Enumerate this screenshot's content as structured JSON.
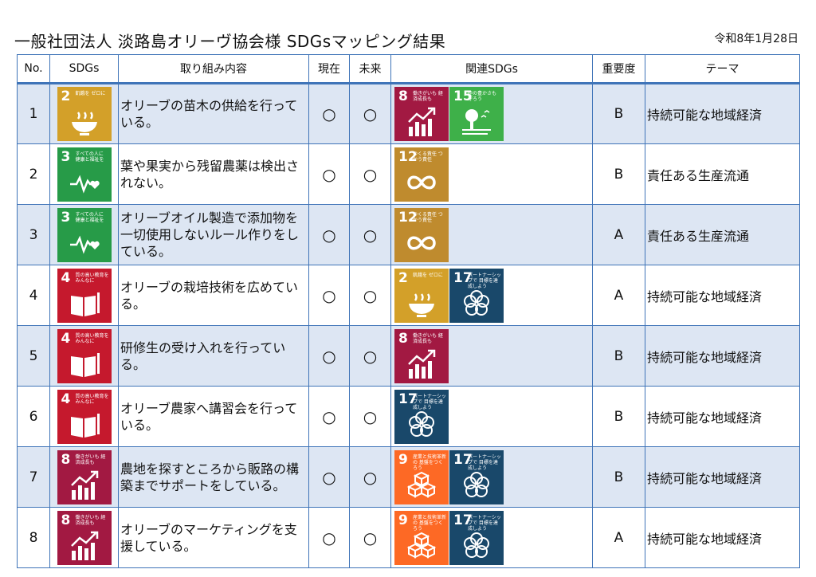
{
  "header": {
    "title": "一般社団法人 淡路島オリーヴ協会様 SDGsマッピング結果",
    "date": "令和8年1月28日"
  },
  "columns": [
    "No.",
    "SDGs",
    "取り組み内容",
    "現在",
    "未来",
    "関連SDGs",
    "重要度",
    "テーマ"
  ],
  "goal_tiles": {
    "g2": {
      "num": "2",
      "text": "飢餓を ゼロに",
      "color": "#d3a029",
      "icon": "bowl-icon"
    },
    "g3": {
      "num": "3",
      "text": "すべての人に 健康と福祉を",
      "color": "#279b48",
      "icon": "heartbeat-icon"
    },
    "g4": {
      "num": "4",
      "text": "質の高い教育を みんなに",
      "color": "#c5192d",
      "icon": "book-icon"
    },
    "g8": {
      "num": "8",
      "text": "働きがいも 経済成長も",
      "color": "#a21942",
      "icon": "growth-chart-icon"
    },
    "g9": {
      "num": "9",
      "text": "産業と技術革新の 基盤をつくろう",
      "color": "#fd6925",
      "icon": "cubes-icon"
    },
    "g12": {
      "num": "12",
      "text": "つくる責任 つかう責任",
      "color": "#bf8b2e",
      "icon": "infinity-icon"
    },
    "g15": {
      "num": "15",
      "text": "陸の豊かさも 守ろう",
      "color": "#3eb049",
      "icon": "tree-icon"
    },
    "g17": {
      "num": "17",
      "text": "パートナーシップで 目標を達成しよう",
      "color": "#19486a",
      "icon": "rings-icon"
    }
  },
  "rows": [
    {
      "no": "1",
      "sdg": "g2",
      "content": "オリーブの苗木の供給を行っている。",
      "now": "○",
      "future": "○",
      "related": [
        "g8",
        "g15"
      ],
      "importance": "B",
      "theme": "持続可能な地域経済"
    },
    {
      "no": "2",
      "sdg": "g3",
      "content": "葉や果実から残留農薬は検出されない。",
      "now": "○",
      "future": "○",
      "related": [
        "g12"
      ],
      "importance": "B",
      "theme": "責任ある生産流通"
    },
    {
      "no": "3",
      "sdg": "g3",
      "content": "オリーブオイル製造で添加物を一切使用しないルール作りをしている。",
      "now": "○",
      "future": "○",
      "related": [
        "g12"
      ],
      "importance": "A",
      "theme": "責任ある生産流通"
    },
    {
      "no": "4",
      "sdg": "g4",
      "content": "オリーブの栽培技術を広めている。",
      "now": "○",
      "future": "○",
      "related": [
        "g2",
        "g17"
      ],
      "importance": "A",
      "theme": "持続可能な地域経済"
    },
    {
      "no": "5",
      "sdg": "g4",
      "content": "研修生の受け入れを行っている。",
      "now": "○",
      "future": "○",
      "related": [
        "g8"
      ],
      "importance": "B",
      "theme": "持続可能な地域経済"
    },
    {
      "no": "6",
      "sdg": "g4",
      "content": "オリーブ農家へ講習会を行っている。",
      "now": "○",
      "future": "○",
      "related": [
        "g17"
      ],
      "importance": "B",
      "theme": "持続可能な地域経済"
    },
    {
      "no": "7",
      "sdg": "g8",
      "content": "農地を探すところから販路の構築までサポートをしている。",
      "now": "○",
      "future": "○",
      "related": [
        "g9",
        "g17"
      ],
      "importance": "B",
      "theme": "持続可能な地域経済"
    },
    {
      "no": "8",
      "sdg": "g8",
      "content": "オリーブのマーケティングを支援している。",
      "now": "○",
      "future": "○",
      "related": [
        "g9",
        "g17"
      ],
      "importance": "A",
      "theme": "持続可能な地域経済"
    }
  ]
}
